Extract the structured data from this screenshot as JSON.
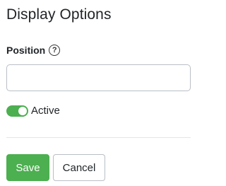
{
  "panel": {
    "title": "Display Options"
  },
  "position_field": {
    "label": "Position",
    "help_icon": "question-circle-icon",
    "value": "",
    "placeholder": ""
  },
  "active_toggle": {
    "label": "Active",
    "checked": true,
    "color": "#4caf50"
  },
  "actions": {
    "save_label": "Save",
    "cancel_label": "Cancel",
    "save_color": "#4caf50"
  }
}
